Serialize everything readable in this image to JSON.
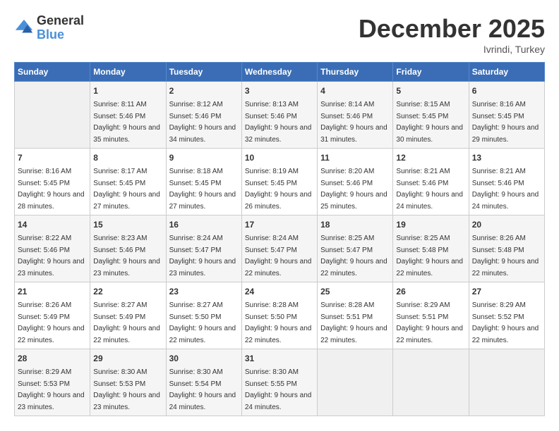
{
  "logo": {
    "general": "General",
    "blue": "Blue"
  },
  "title": "December 2025",
  "location": "Ivrindi, Turkey",
  "days_header": [
    "Sunday",
    "Monday",
    "Tuesday",
    "Wednesday",
    "Thursday",
    "Friday",
    "Saturday"
  ],
  "weeks": [
    [
      {
        "day": "",
        "sunrise": "",
        "sunset": "",
        "daylight": ""
      },
      {
        "day": "1",
        "sunrise": "8:11 AM",
        "sunset": "5:46 PM",
        "daylight": "9 hours and 35 minutes."
      },
      {
        "day": "2",
        "sunrise": "8:12 AM",
        "sunset": "5:46 PM",
        "daylight": "9 hours and 34 minutes."
      },
      {
        "day": "3",
        "sunrise": "8:13 AM",
        "sunset": "5:46 PM",
        "daylight": "9 hours and 32 minutes."
      },
      {
        "day": "4",
        "sunrise": "8:14 AM",
        "sunset": "5:46 PM",
        "daylight": "9 hours and 31 minutes."
      },
      {
        "day": "5",
        "sunrise": "8:15 AM",
        "sunset": "5:45 PM",
        "daylight": "9 hours and 30 minutes."
      },
      {
        "day": "6",
        "sunrise": "8:16 AM",
        "sunset": "5:45 PM",
        "daylight": "9 hours and 29 minutes."
      }
    ],
    [
      {
        "day": "7",
        "sunrise": "8:16 AM",
        "sunset": "5:45 PM",
        "daylight": "9 hours and 28 minutes."
      },
      {
        "day": "8",
        "sunrise": "8:17 AM",
        "sunset": "5:45 PM",
        "daylight": "9 hours and 27 minutes."
      },
      {
        "day": "9",
        "sunrise": "8:18 AM",
        "sunset": "5:45 PM",
        "daylight": "9 hours and 27 minutes."
      },
      {
        "day": "10",
        "sunrise": "8:19 AM",
        "sunset": "5:45 PM",
        "daylight": "9 hours and 26 minutes."
      },
      {
        "day": "11",
        "sunrise": "8:20 AM",
        "sunset": "5:46 PM",
        "daylight": "9 hours and 25 minutes."
      },
      {
        "day": "12",
        "sunrise": "8:21 AM",
        "sunset": "5:46 PM",
        "daylight": "9 hours and 24 minutes."
      },
      {
        "day": "13",
        "sunrise": "8:21 AM",
        "sunset": "5:46 PM",
        "daylight": "9 hours and 24 minutes."
      }
    ],
    [
      {
        "day": "14",
        "sunrise": "8:22 AM",
        "sunset": "5:46 PM",
        "daylight": "9 hours and 23 minutes."
      },
      {
        "day": "15",
        "sunrise": "8:23 AM",
        "sunset": "5:46 PM",
        "daylight": "9 hours and 23 minutes."
      },
      {
        "day": "16",
        "sunrise": "8:24 AM",
        "sunset": "5:47 PM",
        "daylight": "9 hours and 23 minutes."
      },
      {
        "day": "17",
        "sunrise": "8:24 AM",
        "sunset": "5:47 PM",
        "daylight": "9 hours and 22 minutes."
      },
      {
        "day": "18",
        "sunrise": "8:25 AM",
        "sunset": "5:47 PM",
        "daylight": "9 hours and 22 minutes."
      },
      {
        "day": "19",
        "sunrise": "8:25 AM",
        "sunset": "5:48 PM",
        "daylight": "9 hours and 22 minutes."
      },
      {
        "day": "20",
        "sunrise": "8:26 AM",
        "sunset": "5:48 PM",
        "daylight": "9 hours and 22 minutes."
      }
    ],
    [
      {
        "day": "21",
        "sunrise": "8:26 AM",
        "sunset": "5:49 PM",
        "daylight": "9 hours and 22 minutes."
      },
      {
        "day": "22",
        "sunrise": "8:27 AM",
        "sunset": "5:49 PM",
        "daylight": "9 hours and 22 minutes."
      },
      {
        "day": "23",
        "sunrise": "8:27 AM",
        "sunset": "5:50 PM",
        "daylight": "9 hours and 22 minutes."
      },
      {
        "day": "24",
        "sunrise": "8:28 AM",
        "sunset": "5:50 PM",
        "daylight": "9 hours and 22 minutes."
      },
      {
        "day": "25",
        "sunrise": "8:28 AM",
        "sunset": "5:51 PM",
        "daylight": "9 hours and 22 minutes."
      },
      {
        "day": "26",
        "sunrise": "8:29 AM",
        "sunset": "5:51 PM",
        "daylight": "9 hours and 22 minutes."
      },
      {
        "day": "27",
        "sunrise": "8:29 AM",
        "sunset": "5:52 PM",
        "daylight": "9 hours and 22 minutes."
      }
    ],
    [
      {
        "day": "28",
        "sunrise": "8:29 AM",
        "sunset": "5:53 PM",
        "daylight": "9 hours and 23 minutes."
      },
      {
        "day": "29",
        "sunrise": "8:30 AM",
        "sunset": "5:53 PM",
        "daylight": "9 hours and 23 minutes."
      },
      {
        "day": "30",
        "sunrise": "8:30 AM",
        "sunset": "5:54 PM",
        "daylight": "9 hours and 24 minutes."
      },
      {
        "day": "31",
        "sunrise": "8:30 AM",
        "sunset": "5:55 PM",
        "daylight": "9 hours and 24 minutes."
      },
      {
        "day": "",
        "sunrise": "",
        "sunset": "",
        "daylight": ""
      },
      {
        "day": "",
        "sunrise": "",
        "sunset": "",
        "daylight": ""
      },
      {
        "day": "",
        "sunrise": "",
        "sunset": "",
        "daylight": ""
      }
    ]
  ]
}
